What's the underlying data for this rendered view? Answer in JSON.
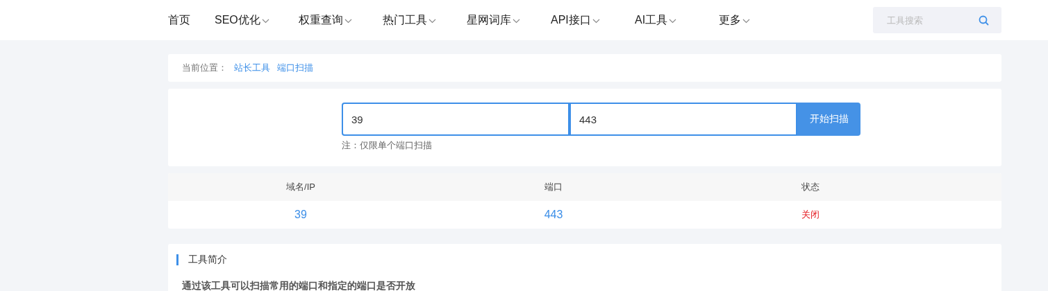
{
  "nav": {
    "items": [
      {
        "label": "首页",
        "has_menu": false
      },
      {
        "label": "SEO优化",
        "has_menu": true
      },
      {
        "label": "权重查询",
        "has_menu": true
      },
      {
        "label": "热门工具",
        "has_menu": true
      },
      {
        "label": "星网词库",
        "has_menu": true
      },
      {
        "label": "API接口",
        "has_menu": true
      },
      {
        "label": "AI工具",
        "has_menu": true
      },
      {
        "label": "更多",
        "has_menu": true
      }
    ],
    "search": {
      "placeholder": "工具搜索"
    }
  },
  "breadcrumb": {
    "label": "当前位置：",
    "links": [
      "站长工具",
      "端口扫描"
    ]
  },
  "scan": {
    "host": "39",
    "port": "443",
    "button": "开始扫描",
    "note": "注：仅限单个端口扫描"
  },
  "table": {
    "columns": [
      "域名/IP",
      "端口",
      "状态"
    ],
    "rows": [
      {
        "host": "39",
        "port": "443",
        "status": "关闭",
        "open": false
      }
    ]
  },
  "intro": {
    "title": "工具简介",
    "text": "通过该工具可以扫描常用的端口和指定的端口是否开放"
  }
}
